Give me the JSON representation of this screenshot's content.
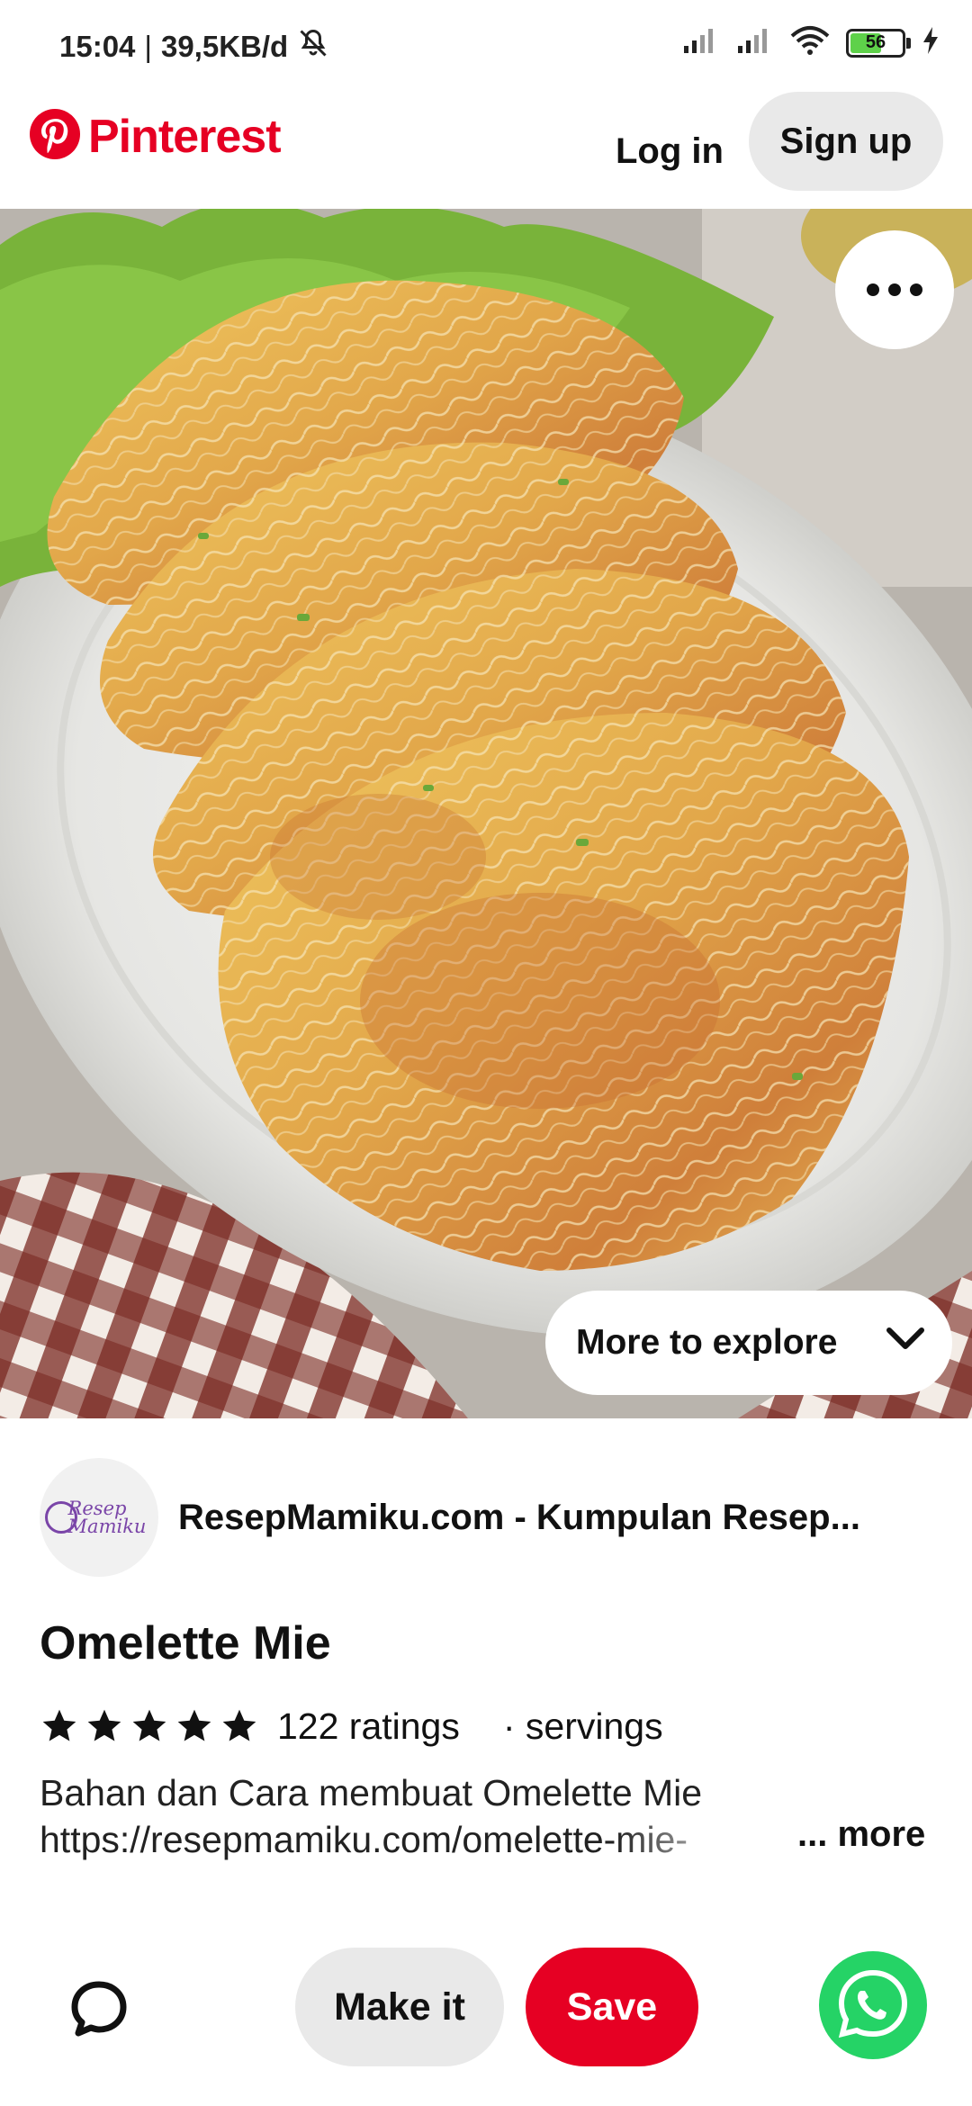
{
  "status_bar": {
    "time": "15:04",
    "network_speed": "39,5KB/d",
    "battery_level": "56",
    "icons": [
      "mute-icon",
      "signal-icon",
      "signal-icon",
      "wifi-icon",
      "battery-icon",
      "charging-icon"
    ]
  },
  "header": {
    "brand": "Pinterest",
    "login_label": "Log in",
    "signup_label": "Sign up"
  },
  "hero": {
    "more_options_icon": "ellipsis-icon",
    "explore_label": "More to explore",
    "explore_icon": "chevron-down-icon"
  },
  "source": {
    "avatar_line1": "Resep",
    "avatar_line2": "Mamiku",
    "name": "ResepMamiku.com - Kumpulan Resep..."
  },
  "pin": {
    "title": "Omelette Mie",
    "rating_stars": 5,
    "ratings_text": "122 ratings",
    "servings_text": "· servings",
    "description_line1": "Bahan dan Cara membuat Omelette Mie",
    "description_line2": "https://resepmamiku.com/omelette-mie-",
    "more_label": "... more"
  },
  "actions": {
    "comment_icon": "comment-icon",
    "make_it_label": "Make it",
    "save_label": "Save",
    "share_icon": "whatsapp-icon"
  },
  "colors": {
    "brand_red": "#e60023",
    "whatsapp_green": "#25d366",
    "button_grey": "#e9e9e9",
    "battery_green": "#5ed14a"
  }
}
